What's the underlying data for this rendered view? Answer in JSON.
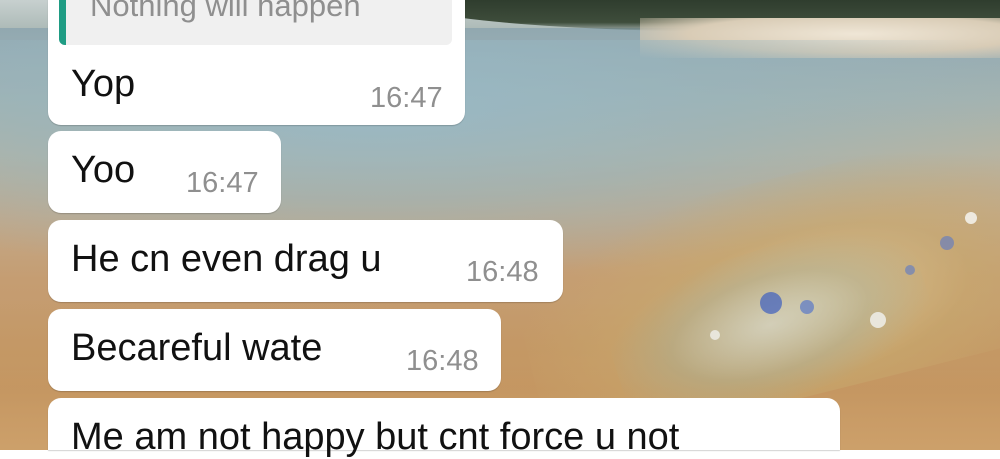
{
  "wallpaper": {
    "description_icon": "beach-wallpaper"
  },
  "quoted_reply": {
    "text": "Nothing will happen",
    "accent_color": "#1f9c84"
  },
  "messages": [
    {
      "text": "Yop",
      "time": "16:47"
    },
    {
      "text": "Yoo",
      "time": "16:47"
    },
    {
      "text": "He cn even drag u",
      "time": "16:48"
    },
    {
      "text": "Becareful wate",
      "time": "16:48"
    },
    {
      "text": "Me am not happy but cnt force u not",
      "time": ""
    }
  ],
  "colors": {
    "bubble": "#ffffff",
    "message_text": "#111111",
    "timestamp": "#8f8f8f"
  }
}
